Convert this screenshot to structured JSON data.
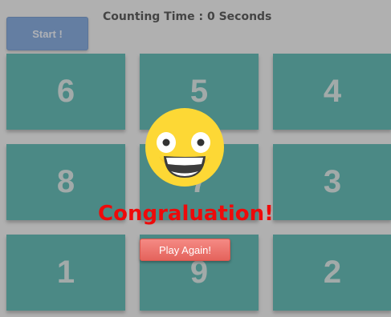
{
  "start_button_label": "Start !",
  "timer_text": "Counting Time : 0 Seconds",
  "cards": [
    "6",
    "5",
    "4",
    "8",
    "7",
    "3",
    "1",
    "9",
    "2"
  ],
  "congrats_text": "Congraluation!",
  "play_again_label": "Play Again!",
  "colors": {
    "card": "#29a59c",
    "start_button": "#5b8ed6",
    "congrats": "#ee0a0a",
    "play_again": "#e96f68",
    "emoji_face": "#fdd835"
  },
  "icons": {
    "celebration": "grinning-face-icon"
  }
}
